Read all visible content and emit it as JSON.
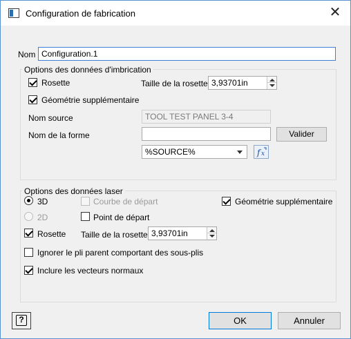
{
  "window": {
    "title": "Configuration de fabrication",
    "close_glyph": "✕"
  },
  "name_field": {
    "label": "Nom",
    "value": "Configuration.1"
  },
  "nesting": {
    "group_title": "Options des données d'imbrication",
    "rosette_label": "Rosette",
    "rosette_checked": true,
    "rosette_size_label": "Taille de la rosette",
    "rosette_size_value": "3,93701in",
    "extra_geometry_label": "Géométrie supplémentaire",
    "extra_geometry_checked": true,
    "source_name_label": "Nom source",
    "source_name_value": "TOOL TEST PANEL 3-4",
    "shape_name_label": "Nom de la forme",
    "shape_name_value": "",
    "validate_label": "Valider",
    "source_select_value": "%SOURCE%",
    "formula_icon": "formula-icon"
  },
  "laser": {
    "group_title": "Options des données laser",
    "mode_3d_label": "3D",
    "mode_2d_label": "2D",
    "selected_mode": "3D",
    "start_curve_label": "Courbe de départ",
    "start_point_label": "Point de départ",
    "extra_geometry_label": "Géométrie supplémentaire",
    "extra_geometry_checked": true,
    "rosette_label": "Rosette",
    "rosette_checked": true,
    "rosette_size_label": "Taille de la rosette",
    "rosette_size_value": "3,93701in",
    "ignore_parent_ply_label": "Ignorer le pli parent comportant des sous-plis",
    "ignore_parent_ply_checked": false,
    "include_normals_label": "Inclure les vecteurs normaux",
    "include_normals_checked": true
  },
  "footer": {
    "help_icon": "help-icon",
    "help_glyph": "?",
    "ok_label": "OK",
    "cancel_label": "Annuler"
  },
  "colors": {
    "accent": "#0078d7",
    "window_border": "#5a8fd0",
    "dialog_bg": "#f0f0f0"
  }
}
